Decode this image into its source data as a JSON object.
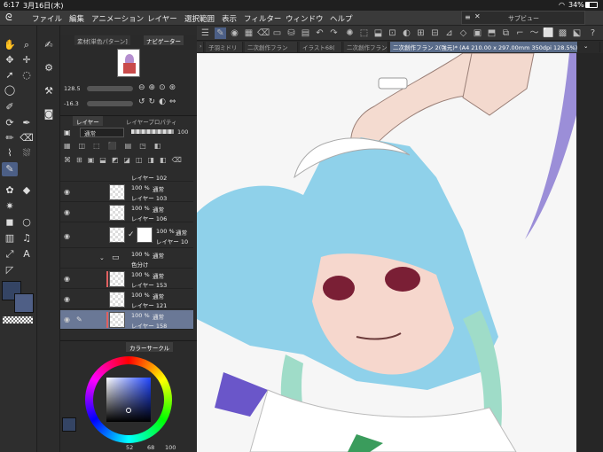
{
  "status": {
    "time": "6:17",
    "date": "3月16日(木)",
    "battery": "34%"
  },
  "menu": [
    "ファイル",
    "編集",
    "アニメーション",
    "レイヤー",
    "選択範囲",
    "表示",
    "フィルター",
    "ウィンドウ",
    "ヘルプ"
  ],
  "subview_title": "サブビュー",
  "tabs": [
    "素材[単色パターン]",
    "ナビゲーター",
    "子羽ミドリ",
    "二次創作フラン",
    "イラスト68(",
    "二次創作フラン 2(強元)* (A4 210.00 x 297.00mm 350dpi 128.5%)"
  ],
  "navigator": {
    "zoom": "128.5",
    "rotate": "-16.3"
  },
  "layer_panel": {
    "tab_layer": "レイヤー",
    "tab_property": "レイヤープロパティ",
    "blend_mode": "通常",
    "opacity": "100",
    "rows": [
      {
        "pct": "",
        "mode": "",
        "name": "レイヤー 102"
      },
      {
        "pct": "100 %",
        "mode": "通常",
        "name": "レイヤー 103"
      },
      {
        "pct": "100 %",
        "mode": "通常",
        "name": "レイヤー 106"
      },
      {
        "pct": "100 %",
        "mode": "通常",
        "name": "レイヤー 10"
      },
      {
        "pct": "100 %",
        "mode": "通常",
        "name": "色分け"
      },
      {
        "pct": "100 %",
        "mode": "通常",
        "name": "レイヤー 153"
      },
      {
        "pct": "100 %",
        "mode": "通常",
        "name": "レイヤー 121"
      },
      {
        "pct": "100 %",
        "mode": "通常",
        "name": "レイヤー 158"
      }
    ]
  },
  "color": {
    "panel_title": "カラーサークル",
    "r": "52",
    "g": "68",
    "b": "100",
    "main_color": "#344464"
  }
}
